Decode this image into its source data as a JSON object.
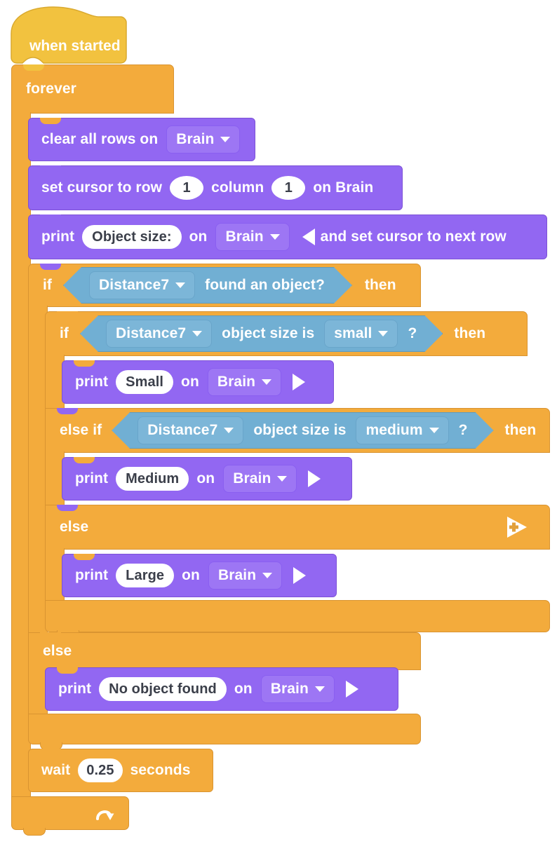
{
  "program": {
    "title": "VEX VR Blocks workspace",
    "colors": {
      "event": "#f2c23f",
      "control": "#f3ab3c",
      "looks": "#9267f2",
      "sensing": "#71afd3",
      "field_text": "#3b3f4a",
      "block_text": "#ffffff",
      "canvas": "#ffffff"
    },
    "hat": {
      "label": "when started"
    },
    "forever": {
      "label": "forever"
    },
    "clear_rows": {
      "label": "clear all rows on",
      "device": "Brain",
      "device_icon": "chevron-down-icon"
    },
    "set_cursor": {
      "label_1": "set cursor to row",
      "row": "1",
      "label_2": "column",
      "column": "1",
      "label_3": "on Brain"
    },
    "print_header": {
      "label": "print",
      "text": "Object size:",
      "on": "on",
      "device": "Brain",
      "device_icon": "chevron-down-icon",
      "mode_icon": "triangle-left-icon",
      "mode_label": "and set cursor to next row"
    },
    "if_found": {
      "if_label": "if",
      "then_label": "then",
      "condition": {
        "device": "Distance7",
        "device_icon": "chevron-down-icon",
        "text": "found an object?"
      }
    },
    "if_small": {
      "if_label": "if",
      "then_label": "then",
      "condition": {
        "device": "Distance7",
        "device_icon": "chevron-down-icon",
        "text": "object size is",
        "size": "small",
        "size_icon": "chevron-down-icon",
        "suffix": "?"
      },
      "body": {
        "label": "print",
        "text": "Small",
        "on": "on",
        "device": "Brain",
        "device_icon": "chevron-down-icon",
        "mode_icon": "triangle-right-icon"
      }
    },
    "elseif_medium": {
      "elseif_label": "else if",
      "then_label": "then",
      "condition": {
        "device": "Distance7",
        "device_icon": "chevron-down-icon",
        "text": "object size is",
        "size": "medium",
        "size_icon": "chevron-down-icon",
        "suffix": "?"
      },
      "body": {
        "label": "print",
        "text": "Medium",
        "on": "on",
        "device": "Brain",
        "device_icon": "chevron-down-icon",
        "mode_icon": "triangle-right-icon"
      }
    },
    "inner_else": {
      "else_label": "else",
      "add_icon": "add-branch-triangle-icon",
      "body": {
        "label": "print",
        "text": "Large",
        "on": "on",
        "device": "Brain",
        "device_icon": "chevron-down-icon",
        "mode_icon": "triangle-right-icon"
      }
    },
    "outer_else": {
      "else_label": "else",
      "body": {
        "label": "print",
        "text": "No object found",
        "on": "on",
        "device": "Brain",
        "device_icon": "chevron-down-icon",
        "mode_icon": "triangle-right-icon"
      }
    },
    "wait": {
      "label_1": "wait",
      "seconds": "0.25",
      "label_2": "seconds"
    },
    "loop_foot": {
      "icon": "loop-arrow-icon"
    }
  }
}
